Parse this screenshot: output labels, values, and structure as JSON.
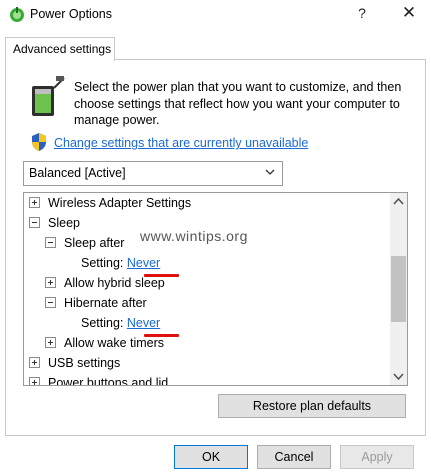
{
  "window": {
    "title": "Power Options",
    "help_glyph": "?",
    "close_glyph": "✕"
  },
  "tab": {
    "label": "Advanced settings"
  },
  "intro_text": "Select the power plan that you want to customize, and then choose settings that reflect how you want your computer to manage power.",
  "change_settings_link": "Change settings that are currently unavailable",
  "plan_dropdown": {
    "selected": "Balanced [Active]"
  },
  "tree": {
    "wireless": "Wireless Adapter Settings",
    "sleep": "Sleep",
    "sleep_after": "Sleep after",
    "sleep_after_setting_label": "Setting:",
    "sleep_after_value": "Never",
    "allow_hybrid": "Allow hybrid sleep",
    "hibernate_after": "Hibernate after",
    "hibernate_setting_label": "Setting:",
    "hibernate_value": "Never",
    "allow_wake": "Allow wake timers",
    "usb": "USB settings",
    "power_buttons": "Power buttons and lid"
  },
  "watermark": "www.wintips.org",
  "buttons": {
    "restore": "Restore plan defaults",
    "ok": "OK",
    "cancel": "Cancel",
    "apply": "Apply"
  },
  "colors": {
    "link": "#1a6ad4",
    "highlight_mark": "#e01010"
  }
}
